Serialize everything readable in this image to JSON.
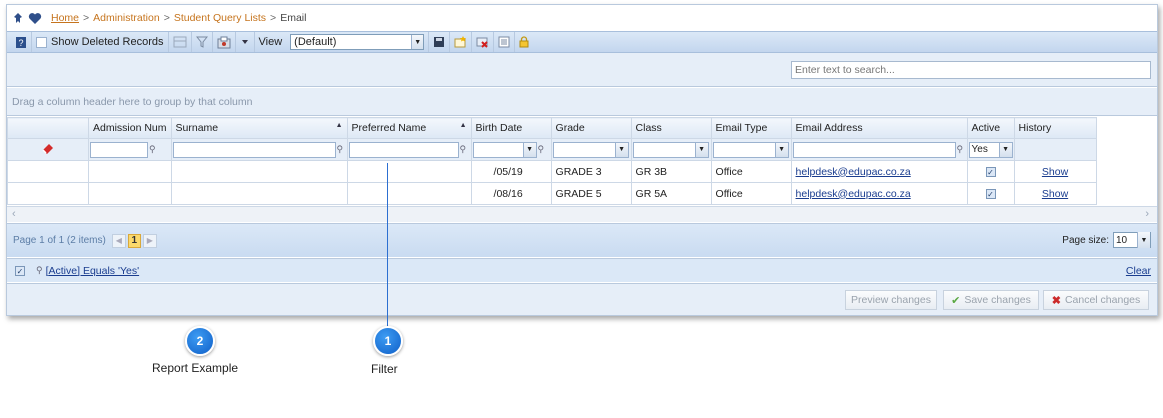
{
  "breadcrumb": {
    "items": [
      "Home",
      "Administration",
      "Student Query Lists",
      "Email"
    ],
    "separator": ">"
  },
  "toolbar": {
    "show_deleted_label": "Show Deleted Records",
    "view_label": "View",
    "view_value": "(Default)"
  },
  "search": {
    "placeholder": "Enter text to search..."
  },
  "group_hint": "Drag a column header here to group by that column",
  "columns": [
    "Admission Num",
    "Surname",
    "Preferred Name",
    "Birth Date",
    "Grade",
    "Class",
    "Email Type",
    "Email Address",
    "Active",
    "History"
  ],
  "filter_active_value": "Yes",
  "rows": [
    {
      "birth_date": "/05/19",
      "grade": "GRADE 3",
      "class": "GR 3B",
      "email_type": "Office",
      "email": "helpdesk@edupac.co.za",
      "active": true,
      "history": "Show"
    },
    {
      "birth_date": "/08/16",
      "grade": "GRADE 5",
      "class": "GR 5A",
      "email_type": "Office",
      "email": "helpdesk@edupac.co.za",
      "active": true,
      "history": "Show"
    }
  ],
  "pager": {
    "info": "Page 1 of 1 (2 items)",
    "current_page": "1",
    "page_size_label": "Page size:",
    "page_size_value": "10"
  },
  "filter_expression": {
    "text": "[Active] Equals 'Yes'",
    "clear_label": "Clear"
  },
  "footer": {
    "preview": "Preview changes",
    "save": "Save changes",
    "cancel": "Cancel changes"
  },
  "callouts": [
    {
      "number": "2",
      "label": "Report Example"
    },
    {
      "number": "1",
      "label": "Filter"
    }
  ],
  "colors": {
    "link": "#c6741d",
    "toolbar": "#c3d6ee",
    "callout": "#1f7ae0"
  }
}
